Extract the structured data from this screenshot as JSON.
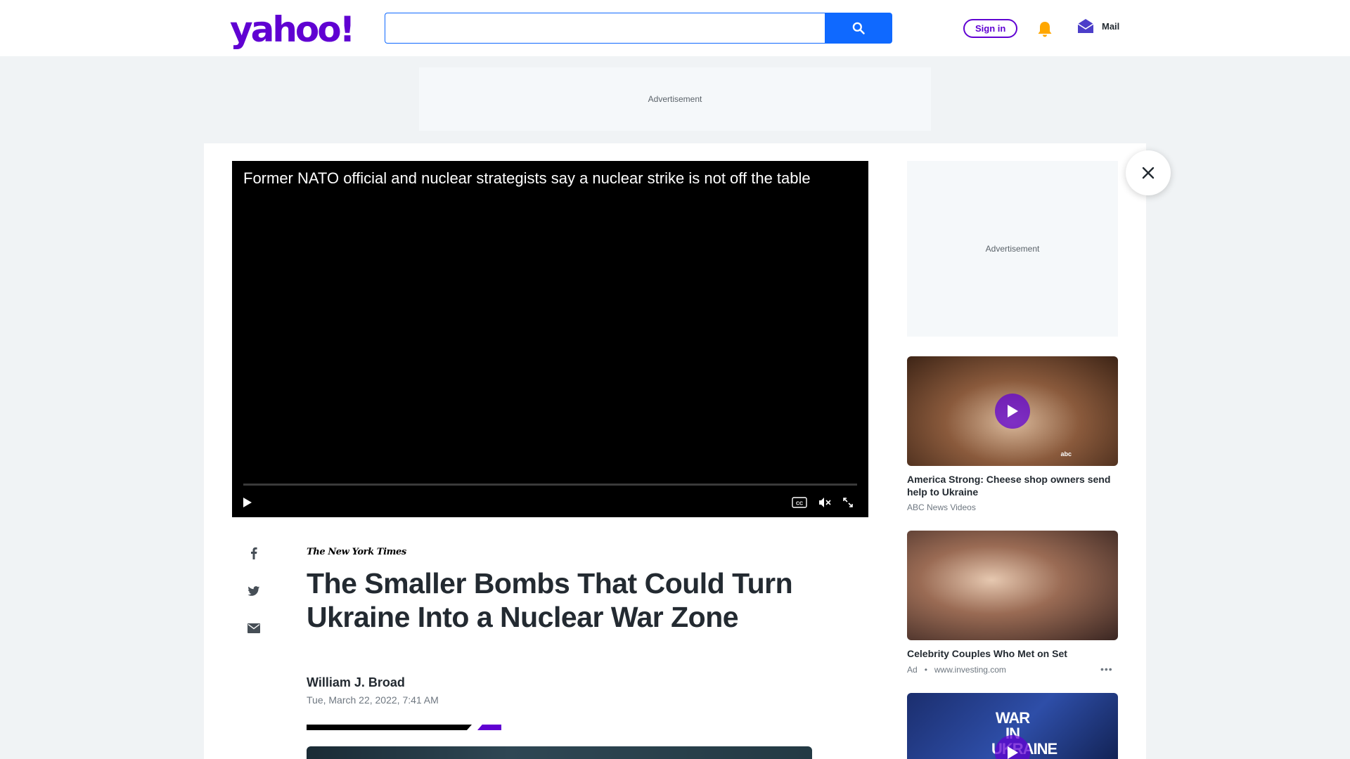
{
  "header": {
    "logo": "yahoo!",
    "search_placeholder": "",
    "signin_label": "Sign in",
    "mail_label": "Mail"
  },
  "ads": {
    "top_label": "Advertisement",
    "side_label": "Advertisement"
  },
  "video": {
    "title": "Former NATO official and nuclear strategists say a nuclear strike is not off the table",
    "progress_fraction": 0
  },
  "article": {
    "publisher": "The New York Times",
    "headline": "The Smaller Bombs That Could Turn Ukraine Into a Nuclear War Zone",
    "author": "William J. Broad",
    "date": "Tue, March 22, 2022, 7:41 AM"
  },
  "sidebar": {
    "items": [
      {
        "title": "America Strong: Cheese shop owners send help to Ukraine",
        "source": "ABC News Videos",
        "badge": "abc"
      },
      {
        "title": "Celebrity Couples Who Met on Set",
        "ad_label": "Ad",
        "source": "www.investing.com"
      },
      {
        "overlay_text": "WAR IN UKRAINE"
      }
    ]
  },
  "colors": {
    "brand": "#6001d2",
    "search_blue": "#0f69ff",
    "bell": "#ffa700"
  }
}
